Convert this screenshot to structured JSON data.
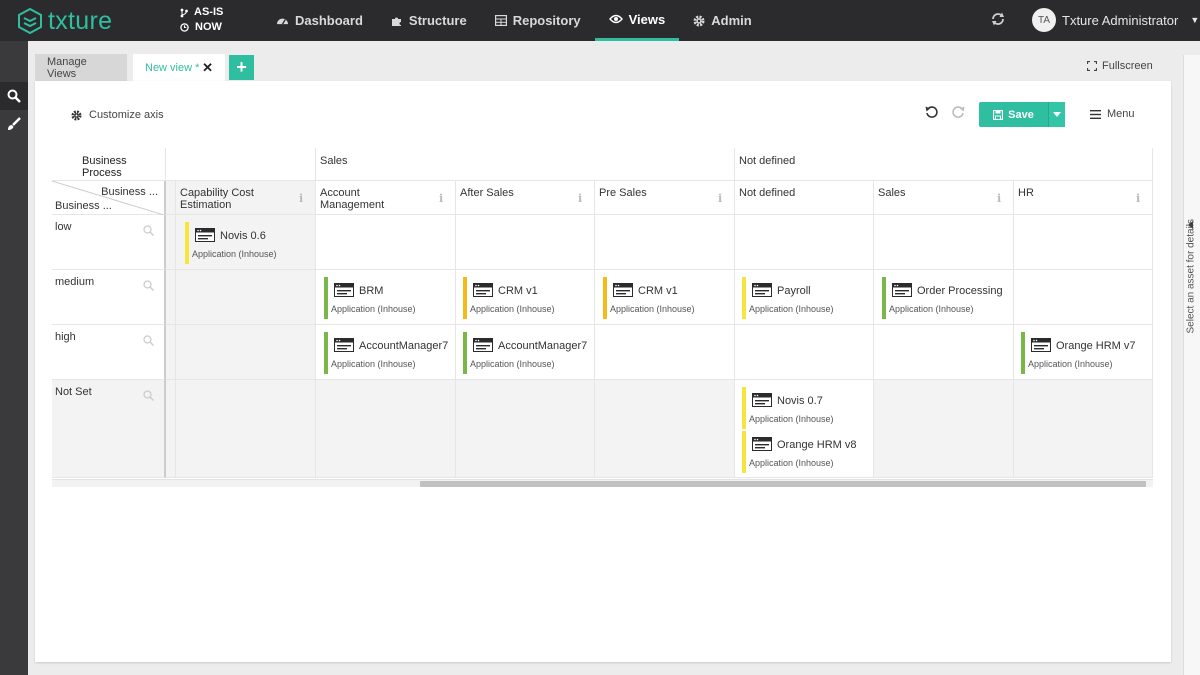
{
  "app": {
    "logo": "txture"
  },
  "timebar": {
    "mode": "AS-IS",
    "time": "NOW"
  },
  "nav": [
    {
      "label": "Dashboard",
      "icon": "dashboard-icon"
    },
    {
      "label": "Structure",
      "icon": "puzzle-icon"
    },
    {
      "label": "Repository",
      "icon": "table-icon"
    },
    {
      "label": "Views",
      "icon": "eye-icon",
      "active": true
    },
    {
      "label": "Admin",
      "icon": "gear-icon"
    }
  ],
  "user": {
    "initials": "TA",
    "name": "Txture Administrator"
  },
  "tabs": {
    "manage": "Manage Views",
    "new_view": "New view *"
  },
  "fullscreen": "Fullscreen",
  "toolbar": {
    "customize": "Customize axis",
    "save": "Save",
    "menu": "Menu"
  },
  "right_panel": "Select an asset for details",
  "colors": {
    "accent": "#2fbfa0",
    "green": "#7ab648",
    "yellow": "#f7e43c",
    "orange": "#f5b918",
    "navbar": "#2b2b2d"
  },
  "grid": {
    "corner_top": "Business Process",
    "corner_x": "Business ...",
    "corner_y": "Business ...",
    "groups": [
      "",
      "Sales",
      "Not defined"
    ],
    "columns": [
      "Capability Cost Estimation",
      "Account Management",
      "After Sales",
      "Pre Sales",
      "Not defined",
      "Sales",
      "HR"
    ],
    "rows": [
      "low",
      "medium",
      "high",
      "Not Set"
    ],
    "cards": [
      {
        "name": "Novis 0.6",
        "type": "Application (Inhouse)",
        "status": "yellow"
      },
      {
        "name": "BRM",
        "type": "Application (Inhouse)",
        "status": "green"
      },
      {
        "name": "CRM v1",
        "type": "Application (Inhouse)",
        "status": "orange"
      },
      {
        "name": "CRM v1",
        "type": "Application (Inhouse)",
        "status": "orange"
      },
      {
        "name": "Payroll",
        "type": "Application (Inhouse)",
        "status": "yellow"
      },
      {
        "name": "Order Processing",
        "type": "Application (Inhouse)",
        "status": "green"
      },
      {
        "name": "AccountManager7",
        "type": "Application (Inhouse)",
        "status": "green"
      },
      {
        "name": "AccountManager7",
        "type": "Application (Inhouse)",
        "status": "green"
      },
      {
        "name": "Orange HRM v7",
        "type": "Application (Inhouse)",
        "status": "green"
      },
      {
        "name": "Novis 0.7",
        "type": "Application (Inhouse)",
        "status": "yellow"
      },
      {
        "name": "Orange HRM v8",
        "type": "Application (Inhouse)",
        "status": "yellow"
      }
    ]
  }
}
